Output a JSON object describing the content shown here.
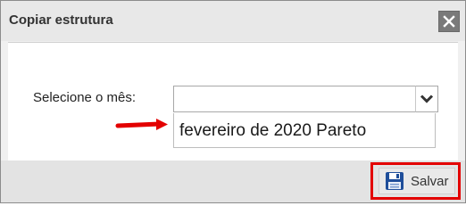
{
  "dialog": {
    "title": "Copiar estrutura",
    "close_icon": "close-icon"
  },
  "form": {
    "month_label": "Selecione o mês:",
    "month_value": "",
    "dropdown_toggle_icon": "chevron-down-icon",
    "options": [
      "fevereiro de 2020 Pareto"
    ]
  },
  "annotation": {
    "arrow_color": "#e30000",
    "highlight_color": "#e30000"
  },
  "footer": {
    "save_label": "Salvar",
    "save_icon": "floppy-disk-icon",
    "save_icon_color": "#1f4e9a"
  }
}
